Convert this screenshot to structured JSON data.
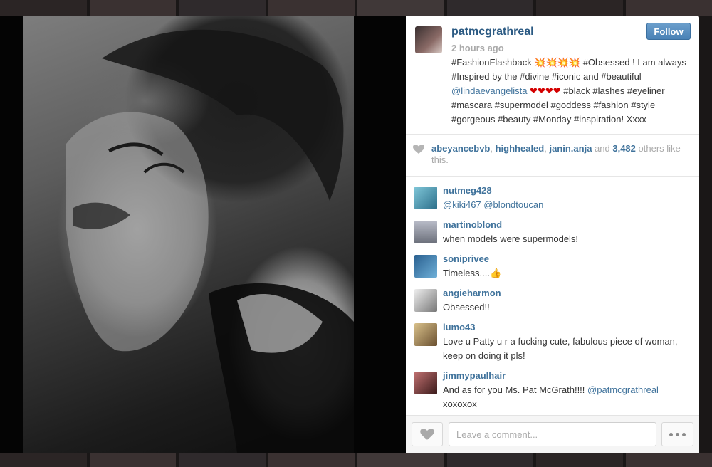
{
  "post": {
    "username": "patmcgrathreal",
    "time": "2 hours ago",
    "follow_label": "Follow",
    "caption": {
      "part1": "#FashionFlashback ",
      "bursts": "💥💥💥💥",
      "part2": " #Obsessed ! I am always #Inspired by the #divine #iconic and #beautiful ",
      "mention": "@lindaevangelista",
      "hearts": " ❤❤❤❤ ",
      "part3": "#black #lashes #eyeliner #mascara #supermodel #goddess #fashion #style #gorgeous #beauty #Monday #inspiration! Xxxx"
    }
  },
  "likes": {
    "user1": "abeyancebvb",
    "sep1": ", ",
    "user2": "highhealed",
    "sep2": ", ",
    "user3": "janin.anja",
    "and": " and ",
    "count": "3,482",
    "tail": " others like this."
  },
  "comments": [
    {
      "user": "nutmeg428",
      "text": "",
      "mention": "@kiki467 @blondtoucan",
      "after": "",
      "avatar_color": "#5aa0b8"
    },
    {
      "user": "martinoblond",
      "text": "when models were supermodels!",
      "mention": "",
      "after": "",
      "avatar_color": "#8c8c94"
    },
    {
      "user": "sonipriveе",
      "text": "Timeless....👍",
      "mention": "",
      "after": "",
      "avatar_color": "#3a78a8"
    },
    {
      "user": "angieharmon",
      "text": "Obsessed!!",
      "mention": "",
      "after": "",
      "avatar_color": "#d8d8d8"
    },
    {
      "user": "lumo43",
      "text": "Love u Patty u r a fucking cute, fabulous piece of woman, keep on doing it pls!",
      "mention": "",
      "after": "",
      "avatar_color": "#b09060"
    },
    {
      "user": "jimmypaulhair",
      "text": "And as for you Ms. Pat McGrath!!!! ",
      "mention": "@patmcgrathreal",
      "after": " xoxoxox",
      "avatar_color": "#8a4a4a"
    }
  ],
  "footer": {
    "comment_placeholder": "Leave a comment..."
  },
  "icons": {
    "likes": "heart-icon",
    "like_button": "heart-icon",
    "more_button": "more-dots-icon"
  },
  "colors": {
    "link": "#3f729b",
    "follow_button": "#4a82b6",
    "muted": "#aaaaaa"
  }
}
